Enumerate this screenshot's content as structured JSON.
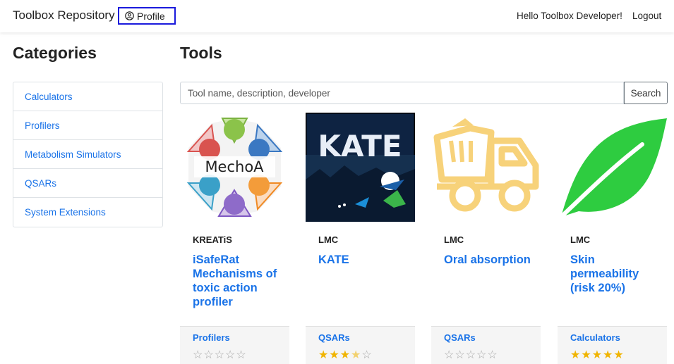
{
  "navbar": {
    "brand": "Toolbox Repository",
    "profile_label": "Profile",
    "greeting": "Hello Toolbox Developer!",
    "logout_label": "Logout"
  },
  "sidebar": {
    "title": "Categories",
    "items": [
      {
        "label": "Calculators"
      },
      {
        "label": "Profilers"
      },
      {
        "label": "Metabolism Simulators"
      },
      {
        "label": "QSARs"
      },
      {
        "label": "System Extensions"
      }
    ]
  },
  "main": {
    "title": "Tools",
    "search": {
      "placeholder": "Tool name, description, developer",
      "value": "",
      "button_label": "Search"
    },
    "tools": [
      {
        "developer": "KREATiS",
        "name": "iSafeRat Mechanisms of toxic action profiler",
        "category": "Profilers",
        "rating": 0,
        "image_text": "MechoA"
      },
      {
        "developer": "LMC",
        "name": "KATE",
        "category": "QSARs",
        "rating": 3.5,
        "image_text": "KATE"
      },
      {
        "developer": "LMC",
        "name": "Oral absorption",
        "category": "QSARs",
        "rating": 0
      },
      {
        "developer": "LMC",
        "name": "Skin permeability (risk 20%)",
        "category": "Calculators",
        "rating": 5
      }
    ]
  },
  "colors": {
    "link": "#1a73e8",
    "star": "#f0b400",
    "leaf": "#2ecc40",
    "truck": "#f7d27a"
  }
}
